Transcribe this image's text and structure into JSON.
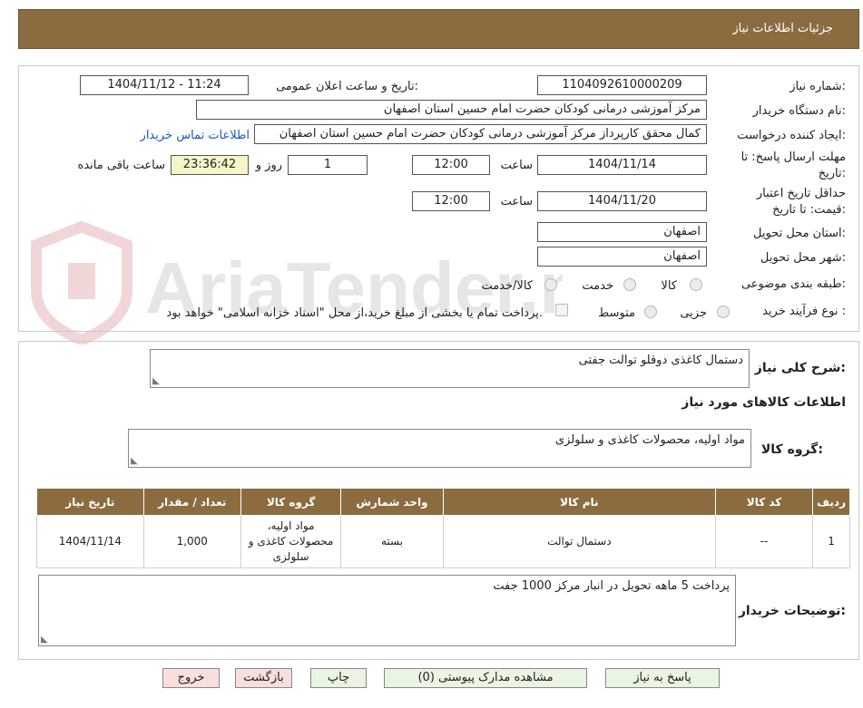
{
  "header": {
    "title": "جزئیات اطلاعات نیاز"
  },
  "fields": {
    "need_number_label": "شماره نیاز:",
    "need_number": "1104092610000209",
    "announce_label": "تاریخ و ساعت اعلان عمومی:",
    "announce_value": "1404/11/12 - 11:24",
    "buyer_org_label": "نام دستگاه خریدار:",
    "buyer_org": "مرکز آموزشی درمانی کودکان حضرت امام حسین استان اصفهان",
    "creator_label": "ایجاد کننده درخواست:",
    "creator": "کمال محقق کارپرداز مرکز آموزشی درمانی کودکان حضرت امام حسین استان اصفهان",
    "contact_link": "اطلاعات تماس خریدار",
    "reply_deadline_label_1": "مهلت ارسال پاسخ: تا",
    "reply_deadline_label_2": "تاریخ:",
    "reply_date": "1404/11/14",
    "time_label": "ساعت",
    "reply_time": "12:00",
    "days": "1",
    "days_label": "روز و",
    "remaining_time": "23:36:42",
    "remaining_label": "ساعت باقی مانده",
    "validity_label_1": "حداقل تاریخ اعتبار",
    "validity_label_2": "قیمت: تا تاریخ:",
    "validity_date": "1404/11/20",
    "validity_time": "12:00",
    "province_label": "استان محل تحویل:",
    "province": "اصفهان",
    "city_label": "شهر محل تحویل:",
    "city": "اصفهان",
    "category_label": "طبقه بندی موضوعی:",
    "category_options": [
      "کالا",
      "خدمت",
      "کالا/خدمت"
    ],
    "process_label": "نوع فرآیند خرید :",
    "process_options": [
      "جزیی",
      "متوسط"
    ],
    "payment_note": "پرداخت تمام یا بخشی از مبلغ خرید،از محل \"اسناد خزانه اسلامی\" خواهد بود."
  },
  "summary": {
    "label": "شرح کلی نیاز:",
    "value": "دستمال کاغذی دوقلو  توالت جفتی"
  },
  "goods": {
    "section_title": "اطلاعات کالاهای مورد نیاز",
    "group_label": "گروه کالا:",
    "group_value": "مواد اولیه، محصولات کاغذی و سلولزی",
    "columns": [
      "ردیف",
      "کد کالا",
      "نام کالا",
      "واحد شمارش",
      "گروه کالا",
      "تعداد / مقدار",
      "تاریخ نیاز"
    ],
    "rows": [
      [
        "1",
        "--",
        "دستمال توالت",
        "بسته",
        "مواد اولیه، محصولات کاغذی و سلولزی",
        "1,000",
        "1404/11/14"
      ]
    ]
  },
  "buyer_notes": {
    "label": "توضیحات خریدار:",
    "value": "پرداخت 5 ماهه تحویل در انبار مرکز  1000 جفت"
  },
  "buttons": {
    "reply": "پاسخ به نیاز",
    "attachments": "مشاهده مدارک پیوستی (0)",
    "print": "چاپ",
    "back": "بازگشت",
    "exit": "خروج"
  },
  "watermark": {
    "text": "AriaTender.neT"
  },
  "colors": {
    "header_bg": "#8b6c40",
    "link": "#1a54c8",
    "timer_bg": "#f5f5c8"
  }
}
